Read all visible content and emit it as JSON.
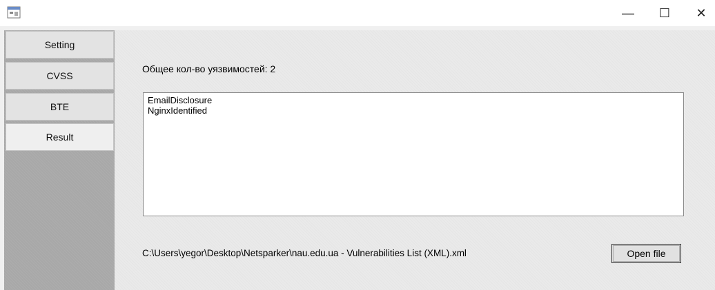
{
  "window": {
    "icon": "app-window-icon",
    "controls": {
      "minimize": "—",
      "maximize": "☐",
      "close": "✕"
    }
  },
  "sidebar": {
    "items": [
      {
        "label": "Setting"
      },
      {
        "label": "CVSS"
      },
      {
        "label": "BTE"
      },
      {
        "label": "Result",
        "active": true
      }
    ]
  },
  "main": {
    "count_label": "Общее кол-во уязвимостей: 2",
    "list_items": [
      "EmailDisclosure",
      "NginxIdentified"
    ],
    "file_path": "C:\\Users\\yegor\\Desktop\\Netsparker\\nau.edu.ua - Vulnerabilities List (XML).xml",
    "open_button": "Open file"
  }
}
